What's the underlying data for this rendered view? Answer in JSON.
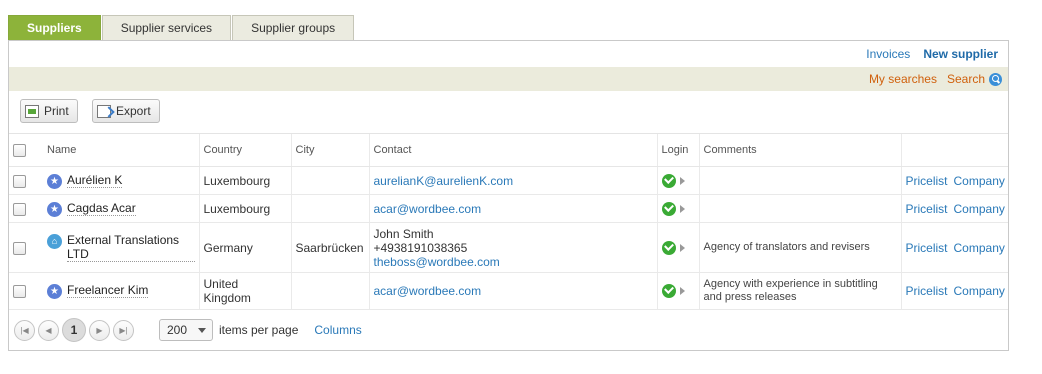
{
  "tabs": [
    {
      "label": "Suppliers",
      "active": true
    },
    {
      "label": "Supplier services",
      "active": false
    },
    {
      "label": "Supplier groups",
      "active": false
    }
  ],
  "toplinks": {
    "invoices": "Invoices",
    "new_supplier": "New supplier"
  },
  "searchbar": {
    "my_searches": "My searches",
    "search": "Search"
  },
  "toolbar": {
    "print": "Print",
    "export": "Export"
  },
  "table": {
    "headers": {
      "name": "Name",
      "country": "Country",
      "city": "City",
      "contact": "Contact",
      "login": "Login",
      "comments": "Comments"
    },
    "rows": [
      {
        "icon": "star-icon",
        "name": "Aurélien K",
        "country": "Luxembourg",
        "city": "",
        "contact_name": "",
        "contact_phone": "",
        "email": "aurelianK@aurelienK.com",
        "comment": "",
        "pricelist": "Pricelist",
        "company": "Company"
      },
      {
        "icon": "star-icon",
        "name": "Cagdas Acar",
        "country": "Luxembourg",
        "city": "",
        "contact_name": "",
        "contact_phone": "",
        "email": "acar@wordbee.com",
        "comment": "",
        "pricelist": "Pricelist",
        "company": "Company"
      },
      {
        "icon": "home-icon",
        "name": "External Translations LTD",
        "country": "Germany",
        "city": "Saarbrücken",
        "contact_name": "John Smith",
        "contact_phone": "+4938191038365",
        "email": "theboss@wordbee.com",
        "comment": "Agency of translators and revisers",
        "pricelist": "Pricelist",
        "company": "Company"
      },
      {
        "icon": "star-icon",
        "name": "Freelancer Kim",
        "country": "United Kingdom",
        "city": "",
        "contact_name": "",
        "contact_phone": "",
        "email": "acar@wordbee.com",
        "comment": "Agency with experience in subtitling and press releases",
        "pricelist": "Pricelist",
        "company": "Company"
      }
    ]
  },
  "pager": {
    "current_page": "1",
    "page_size": "200",
    "items_per_page": "items per page",
    "columns": "Columns"
  }
}
